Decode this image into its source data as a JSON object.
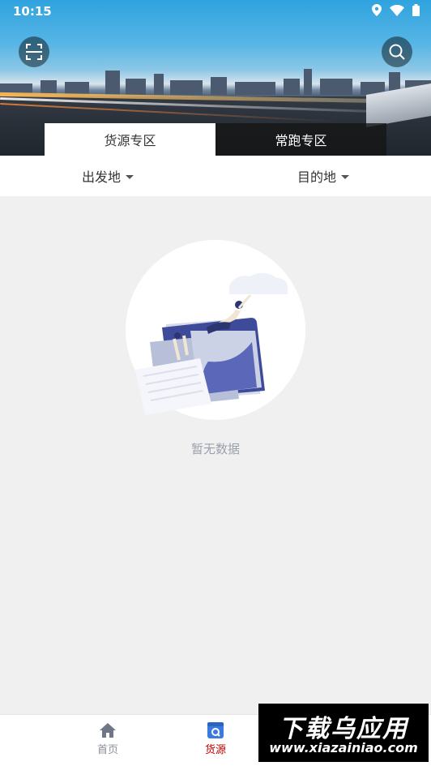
{
  "status_bar": {
    "time": "10:15"
  },
  "header": {
    "scan_icon": "scan-icon",
    "search_icon": "search-icon"
  },
  "tabs": [
    {
      "label": "货源专区",
      "active": true
    },
    {
      "label": "常跑专区",
      "active": false
    }
  ],
  "filters": {
    "origin_label": "出发地",
    "destination_label": "目的地"
  },
  "empty_state": {
    "text": "暂无数据"
  },
  "bottom_nav": {
    "items": [
      {
        "label": "首页",
        "icon": "home-icon",
        "active": false
      },
      {
        "label": "货源",
        "icon": "cargo-source-icon",
        "active": true
      }
    ]
  },
  "watermark": {
    "title": "下载乌应用",
    "url": "www.xiazainiao.com"
  },
  "colors": {
    "accent": "#c00000",
    "tab_inactive_bg": "#1e1e1e",
    "empty_text": "#9aa0ab"
  }
}
